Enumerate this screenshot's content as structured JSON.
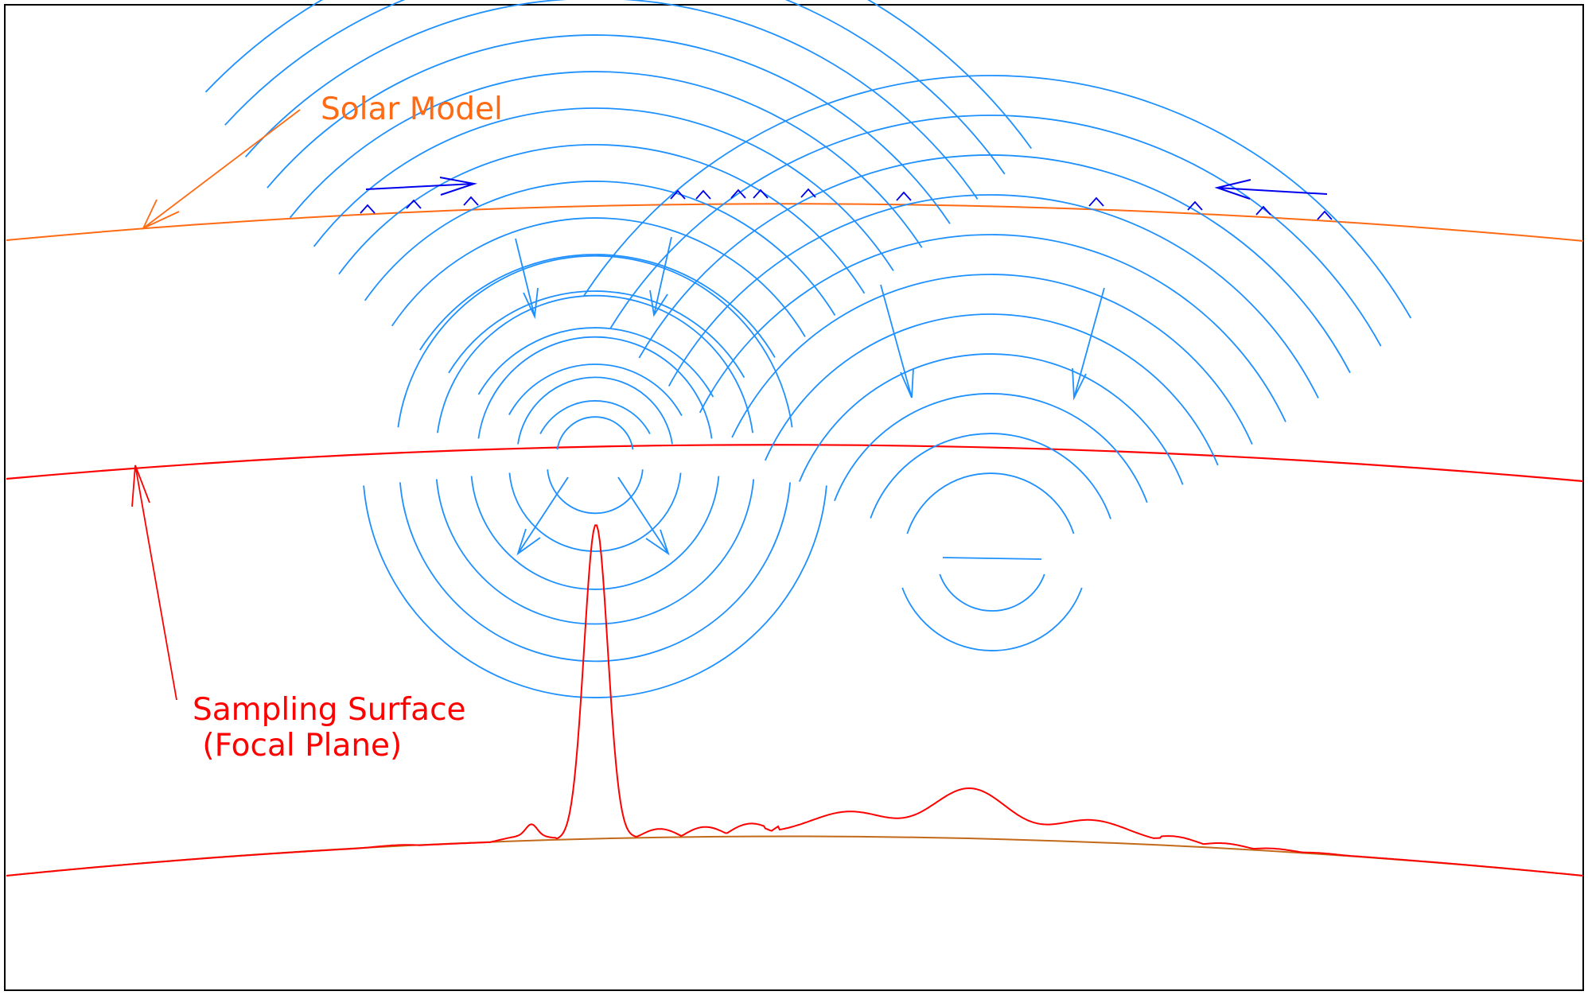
{
  "labels": {
    "solar_model": "Solar Model",
    "sampling_line1": "Sampling Surface",
    "sampling_line2": " (Focal Plane)"
  },
  "colors": {
    "frame": "#000000",
    "solar_model": "#ff6a13",
    "sampling_surface": "#ff0000",
    "waves": "#1e90ff",
    "surface_arrows": "#0000ee",
    "bottom_curve": "#c26a1a"
  }
}
